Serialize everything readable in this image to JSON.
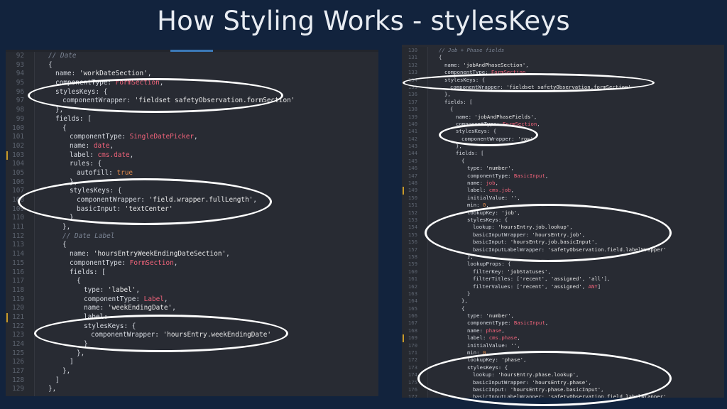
{
  "slide": {
    "title": "How Styling Works - stylesKeys"
  },
  "left_panel": {
    "lines": [
      {
        "n": "92",
        "t": "// Date",
        "c": "c",
        "i": 1
      },
      {
        "n": "93",
        "t": "{",
        "c": "k",
        "i": 1
      },
      {
        "n": "94",
        "t": "name: 'workDateSection',",
        "c": "k",
        "i": 2
      },
      {
        "n": "95",
        "t": "componentType: FormSection,",
        "c": "k",
        "i": 2
      },
      {
        "n": "96",
        "t": "stylesKeys: {",
        "c": "k",
        "i": 2
      },
      {
        "n": "97",
        "t": "componentWrapper: 'fieldset safetyObservation.formSection'",
        "c": "k",
        "i": 3
      },
      {
        "n": "98",
        "t": "},",
        "c": "k",
        "i": 2
      },
      {
        "n": "99",
        "t": "fields: [",
        "c": "k",
        "i": 2
      },
      {
        "n": "100",
        "t": "{",
        "c": "k",
        "i": 3
      },
      {
        "n": "101",
        "t": "componentType: SingleDatePicker,",
        "c": "k",
        "i": 4
      },
      {
        "n": "102",
        "t": "name: date,",
        "c": "k",
        "i": 4
      },
      {
        "n": "103",
        "t": "label: cms.date,",
        "c": "k",
        "i": 4,
        "m": true
      },
      {
        "n": "104",
        "t": "rules: {",
        "c": "k",
        "i": 4
      },
      {
        "n": "105",
        "t": "autofill: true",
        "c": "k",
        "i": 5
      },
      {
        "n": "106",
        "t": "},",
        "c": "k",
        "i": 4
      },
      {
        "n": "107",
        "t": "stylesKeys: {",
        "c": "k",
        "i": 4
      },
      {
        "n": "108",
        "t": "componentWrapper: 'field.wrapper.fullLength',",
        "c": "k",
        "i": 5
      },
      {
        "n": "109",
        "t": "basicInput: 'textCenter'",
        "c": "k",
        "i": 5
      },
      {
        "n": "110",
        "t": "}",
        "c": "k",
        "i": 4
      },
      {
        "n": "111",
        "t": "},",
        "c": "k",
        "i": 3
      },
      {
        "n": "112",
        "t": "// Date Label",
        "c": "c",
        "i": 3
      },
      {
        "n": "113",
        "t": "{",
        "c": "k",
        "i": 3
      },
      {
        "n": "114",
        "t": "name: 'hoursEntryWeekEndingDateSection',",
        "c": "k",
        "i": 4
      },
      {
        "n": "115",
        "t": "componentType: FormSection,",
        "c": "k",
        "i": 4
      },
      {
        "n": "116",
        "t": "fields: [",
        "c": "k",
        "i": 4
      },
      {
        "n": "117",
        "t": "{",
        "c": "k",
        "i": 5
      },
      {
        "n": "118",
        "t": "type: 'label',",
        "c": "k",
        "i": 6
      },
      {
        "n": "119",
        "t": "componentType: Label,",
        "c": "k",
        "i": 6
      },
      {
        "n": "120",
        "t": "name: 'weekEndingDate',",
        "c": "k",
        "i": 6
      },
      {
        "n": "121",
        "t": "label:",
        "c": "k",
        "i": 6,
        "m": true
      },
      {
        "n": "122",
        "t": "stylesKeys: {",
        "c": "k",
        "i": 6
      },
      {
        "n": "123",
        "t": "componentWrapper: 'hoursEntry.weekEndingDate'",
        "c": "k",
        "i": 7
      },
      {
        "n": "124",
        "t": "}",
        "c": "k",
        "i": 6
      },
      {
        "n": "125",
        "t": "},",
        "c": "k",
        "i": 5
      },
      {
        "n": "126",
        "t": "]",
        "c": "k",
        "i": 4
      },
      {
        "n": "127",
        "t": "},",
        "c": "k",
        "i": 3
      },
      {
        "n": "128",
        "t": "]",
        "c": "k",
        "i": 2
      },
      {
        "n": "129",
        "t": "},",
        "c": "k",
        "i": 1
      }
    ]
  },
  "right_panel": {
    "lines": [
      {
        "n": "130",
        "t": "// Job + Phase fields",
        "c": "c",
        "i": 1
      },
      {
        "n": "131",
        "t": "{",
        "c": "k",
        "i": 1
      },
      {
        "n": "132",
        "t": "name: 'jobAndPhaseSection',",
        "c": "k",
        "i": 2
      },
      {
        "n": "133",
        "t": "componentType: FormSection,",
        "c": "k",
        "i": 2
      },
      {
        "n": "134",
        "t": "stylesKeys: {",
        "c": "k",
        "i": 2
      },
      {
        "n": "135",
        "t": "componentWrapper: 'fieldset safetyObservation.formSection'",
        "c": "k",
        "i": 3
      },
      {
        "n": "136",
        "t": "},",
        "c": "k",
        "i": 2
      },
      {
        "n": "137",
        "t": "fields: [",
        "c": "k",
        "i": 2
      },
      {
        "n": "138",
        "t": "{",
        "c": "k",
        "i": 3
      },
      {
        "n": "139",
        "t": "name: 'jobAndPhaseFields',",
        "c": "k",
        "i": 4
      },
      {
        "n": "140",
        "t": "componentType: FormSection,",
        "c": "k",
        "i": 4
      },
      {
        "n": "141",
        "t": "stylesKeys: {",
        "c": "k",
        "i": 4
      },
      {
        "n": "142",
        "t": "componentWrapper: 'row'",
        "c": "k",
        "i": 5
      },
      {
        "n": "143",
        "t": "},",
        "c": "k",
        "i": 4
      },
      {
        "n": "144",
        "t": "fields: [",
        "c": "k",
        "i": 4
      },
      {
        "n": "145",
        "t": "{",
        "c": "k",
        "i": 5
      },
      {
        "n": "146",
        "t": "type: 'number',",
        "c": "k",
        "i": 6
      },
      {
        "n": "147",
        "t": "componentType: BasicInput,",
        "c": "k",
        "i": 6
      },
      {
        "n": "148",
        "t": "name: job,",
        "c": "k",
        "i": 6
      },
      {
        "n": "149",
        "t": "label: cms.job,",
        "c": "k",
        "i": 6,
        "m": true
      },
      {
        "n": "150",
        "t": "initialValue: '',",
        "c": "k",
        "i": 6
      },
      {
        "n": "151",
        "t": "min: 0,",
        "c": "k",
        "i": 6
      },
      {
        "n": "152",
        "t": "lookupKey: 'job',",
        "c": "k",
        "i": 6
      },
      {
        "n": "153",
        "t": "stylesKeys: {",
        "c": "k",
        "i": 6
      },
      {
        "n": "154",
        "t": "lookup: 'hoursEntry.job.lookup',",
        "c": "k",
        "i": 7
      },
      {
        "n": "155",
        "t": "basicInputWrapper: 'hoursEntry.job',",
        "c": "k",
        "i": 7
      },
      {
        "n": "156",
        "t": "basicInput: 'hoursEntry.job.basicInput',",
        "c": "k",
        "i": 7
      },
      {
        "n": "157",
        "t": "basicInputLabelWrapper: 'safetyObservation.field.labelWrapper'",
        "c": "k",
        "i": 7
      },
      {
        "n": "158",
        "t": "},",
        "c": "k",
        "i": 6
      },
      {
        "n": "159",
        "t": "lookupProps: {",
        "c": "k",
        "i": 6
      },
      {
        "n": "160",
        "t": "filterKey: 'jobStatuses',",
        "c": "k",
        "i": 7
      },
      {
        "n": "161",
        "t": "filterTitles: ['recent', 'assigned', 'all'],",
        "c": "k",
        "i": 7
      },
      {
        "n": "162",
        "t": "filterValues: ['recent', 'assigned', ANY]",
        "c": "k",
        "i": 7
      },
      {
        "n": "163",
        "t": "}",
        "c": "k",
        "i": 6
      },
      {
        "n": "164",
        "t": "},",
        "c": "k",
        "i": 5
      },
      {
        "n": "165",
        "t": "{",
        "c": "k",
        "i": 5
      },
      {
        "n": "166",
        "t": "type: 'number',",
        "c": "k",
        "i": 6
      },
      {
        "n": "167",
        "t": "componentType: BasicInput,",
        "c": "k",
        "i": 6
      },
      {
        "n": "168",
        "t": "name: phase,",
        "c": "k",
        "i": 6
      },
      {
        "n": "169",
        "t": "label: cms.phase,",
        "c": "k",
        "i": 6,
        "m": true
      },
      {
        "n": "170",
        "t": "initialValue: '',",
        "c": "k",
        "i": 6
      },
      {
        "n": "171",
        "t": "min: 0,",
        "c": "k",
        "i": 6
      },
      {
        "n": "172",
        "t": "lookupKey: 'phase',",
        "c": "k",
        "i": 6
      },
      {
        "n": "173",
        "t": "stylesKeys: {",
        "c": "k",
        "i": 6
      },
      {
        "n": "174",
        "t": "lookup: 'hoursEntry.phase.lookup',",
        "c": "k",
        "i": 7
      },
      {
        "n": "175",
        "t": "basicInputWrapper: 'hoursEntry.phase',",
        "c": "k",
        "i": 7
      },
      {
        "n": "176",
        "t": "basicInput: 'hoursEntry.phase.basicInput',",
        "c": "k",
        "i": 7
      },
      {
        "n": "177",
        "t": "basicInputLabelWrapper: 'safetyObservation.field.labelWrapper'",
        "c": "k",
        "i": 7
      }
    ]
  },
  "callout_color": "#ffffff"
}
